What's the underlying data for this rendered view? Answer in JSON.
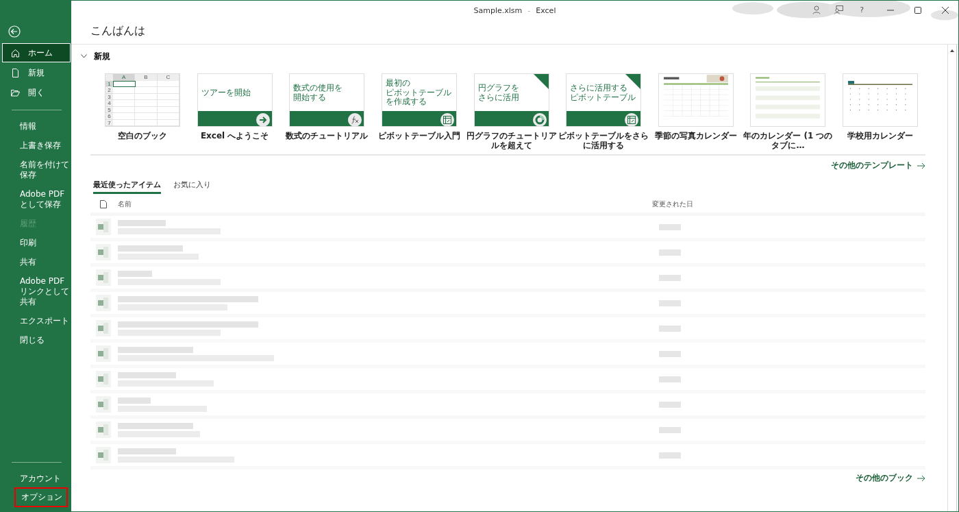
{
  "window": {
    "title_file": "Sample.xlsm",
    "title_sep": "-",
    "title_app": "Excel",
    "controls": [
      "?"
    ]
  },
  "sidebar": {
    "top": [
      {
        "label": "ホーム",
        "kind": "home",
        "selected": true
      },
      {
        "label": "新規",
        "kind": "new",
        "selected": false
      },
      {
        "label": "開く",
        "kind": "open",
        "selected": false
      }
    ],
    "middle": [
      {
        "label": "情報",
        "disabled": false
      },
      {
        "label": "上書き保存",
        "disabled": false
      },
      {
        "label": "名前を付けて保存",
        "disabled": false
      },
      {
        "label": "Adobe PDF として保存",
        "disabled": false
      },
      {
        "label": "履歴",
        "disabled": true
      },
      {
        "label": "印刷",
        "disabled": false
      },
      {
        "label": "共有",
        "disabled": false
      },
      {
        "label": "Adobe PDF リンクとして共有",
        "disabled": false
      },
      {
        "label": "エクスポート",
        "disabled": false
      },
      {
        "label": "閉じる",
        "disabled": false
      }
    ],
    "bottom": [
      {
        "label": "アカウント",
        "highlighted": false
      },
      {
        "label": "オプション",
        "highlighted": true
      }
    ]
  },
  "greeting": "こんばんは",
  "new_section": {
    "title": "新規",
    "expanded": true,
    "templates": [
      {
        "kind": "blank",
        "label": "空白のブック",
        "cols": [
          "A",
          "B",
          "C"
        ],
        "rows": [
          "1",
          "2",
          "3",
          "4",
          "5",
          "6",
          "7"
        ]
      },
      {
        "kind": "tour",
        "label": "Excel へようこそ",
        "big": "ツアーを開始",
        "badge": false
      },
      {
        "kind": "formula",
        "label": "数式のチュートリアル",
        "small": "数式の使用を",
        "big": "開始する",
        "badge": false
      },
      {
        "kind": "pivot",
        "label": "ピボットテーブル入門",
        "small": "最初の",
        "big": "ピボットテーブル",
        "sub": "を作成する",
        "badge": false
      },
      {
        "kind": "pie",
        "label": "円グラフのチュートリアルを超えて",
        "small": "円グラフを",
        "big": "さらに活用",
        "badge": true
      },
      {
        "kind": "pivot",
        "label": "ピボットテーブルをさらに活用する",
        "small": "さらに活用する",
        "big": "ピボットテーブル",
        "badge": true
      },
      {
        "kind": "photo-calendar",
        "label": "季節の写真カレンダー"
      },
      {
        "kind": "year-calendar",
        "label": "年のカレンダー (1 つのタブに…"
      },
      {
        "kind": "school-calendar",
        "label": "学校用カレンダー"
      }
    ],
    "more": "その他のテンプレート"
  },
  "tabs": [
    {
      "label": "最近使ったアイテム",
      "selected": true
    },
    {
      "label": "お気に入り",
      "selected": false
    }
  ],
  "table": {
    "columns": [
      "名前",
      "変更された日"
    ],
    "rows": [
      {
        "kind": "blurred"
      },
      {
        "kind": "blurred"
      },
      {
        "kind": "blurred"
      },
      {
        "kind": "blurred"
      },
      {
        "kind": "blurred"
      },
      {
        "kind": "blurred"
      },
      {
        "kind": "blurred"
      },
      {
        "kind": "blurred"
      },
      {
        "kind": "blurred"
      },
      {
        "kind": "blurred"
      }
    ]
  },
  "more_books": "その他のブック"
}
